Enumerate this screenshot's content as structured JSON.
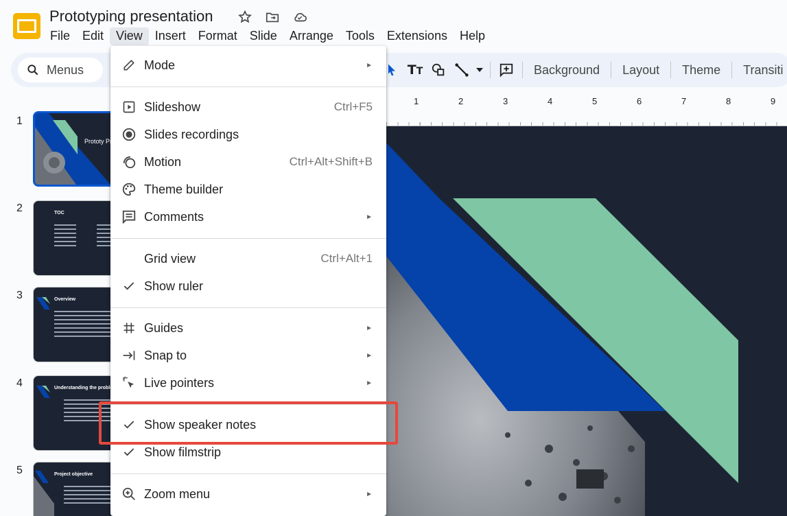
{
  "app": {
    "title": "Prototyping presentation",
    "brand_color": "#f4b400"
  },
  "menubar": [
    "File",
    "Edit",
    "View",
    "Insert",
    "Format",
    "Slide",
    "Arrange",
    "Tools",
    "Extensions",
    "Help"
  ],
  "toolbar": {
    "search_label": "Menus",
    "background_label": "Background",
    "layout_label": "Layout",
    "theme_label": "Theme",
    "transition_label": "Transiti"
  },
  "filmstrip": {
    "slides": [
      {
        "num": "1",
        "title": "Prototy Present"
      },
      {
        "num": "2",
        "title": "TOC"
      },
      {
        "num": "3",
        "title": "Overview"
      },
      {
        "num": "4",
        "title": "Understanding the problem"
      },
      {
        "num": "5",
        "title": "Project objective"
      }
    ]
  },
  "ruler": [
    "1",
    "2",
    "3",
    "4",
    "5",
    "6",
    "7",
    "8",
    "9"
  ],
  "view_menu": {
    "mode": "Mode",
    "slideshow": "Slideshow",
    "slideshow_shortcut": "Ctrl+F5",
    "slides_recordings": "Slides recordings",
    "motion": "Motion",
    "motion_shortcut": "Ctrl+Alt+Shift+B",
    "theme_builder": "Theme builder",
    "comments": "Comments",
    "grid_view": "Grid view",
    "grid_view_shortcut": "Ctrl+Alt+1",
    "show_ruler": "Show ruler",
    "guides": "Guides",
    "snap_to": "Snap to",
    "live_pointers": "Live pointers",
    "show_speaker_notes": "Show speaker notes",
    "show_filmstrip": "Show filmstrip",
    "zoom_menu": "Zoom menu"
  },
  "colors": {
    "accent_blue": "#0b57d0",
    "slide_bg": "#1c2434",
    "slide_blue": "#0543aa",
    "slide_green": "#7fc6a4",
    "highlight_red": "#e5483c"
  }
}
